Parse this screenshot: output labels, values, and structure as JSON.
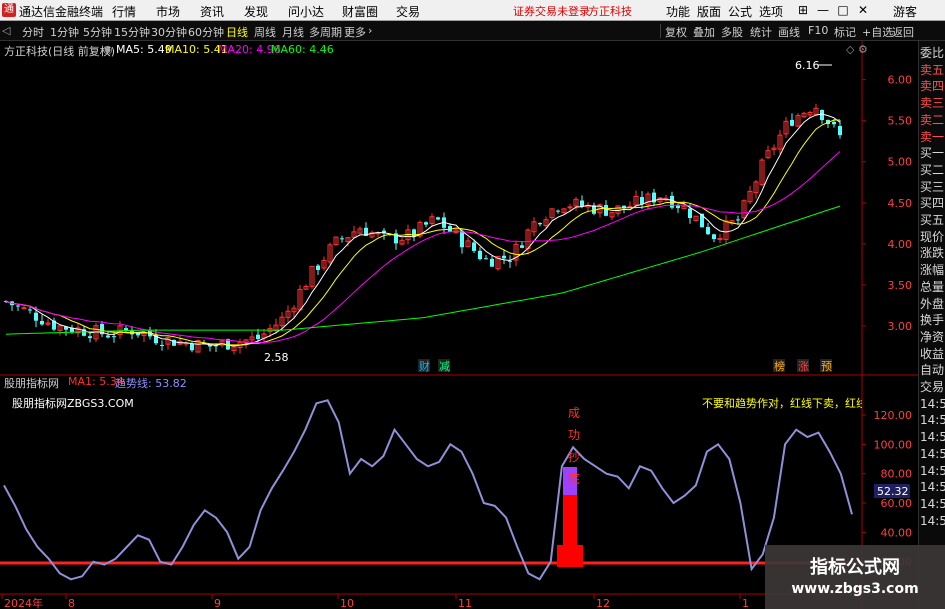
{
  "app": {
    "logo": "通",
    "title": "通达信金融终端",
    "menus": [
      "行情",
      "市场",
      "资讯",
      "发现",
      "问小达",
      "财富圈",
      "交易"
    ],
    "status": [
      "证券交易未登录",
      "方正科技"
    ],
    "right_menus": [
      "功能",
      "版面",
      "公式",
      "选项"
    ],
    "user": "游客"
  },
  "toolbar": {
    "periods": [
      "分时",
      "1分钟",
      "5分钟",
      "15分钟",
      "30分钟",
      "60分钟",
      "日线",
      "周线",
      "月线",
      "多周期",
      "更多"
    ],
    "active": "日线",
    "right_tools": [
      "复权",
      "叠加",
      "多股",
      "统计",
      "画线",
      "F10",
      "标记",
      "+自选",
      "返回"
    ]
  },
  "right_tabs": [
    "委比",
    "卖五",
    "卖四",
    "卖三",
    "卖二",
    "卖一",
    "买一",
    "买二",
    "买三",
    "买四",
    "买五",
    "现价",
    "涨跌",
    "涨幅",
    "总量",
    "外盘",
    "换手",
    "净资",
    "收益",
    "自动",
    "交易",
    "14:56",
    "14:56",
    "14:56",
    "14:56",
    "14:56",
    "14:56",
    "14:56",
    "14:56"
  ],
  "main_chart": {
    "stock_label": "方正科技(日线 前复权)",
    "ma": [
      {
        "label": "MA5: 5.49",
        "color": "#ffffff"
      },
      {
        "label": "MA10: 5.41",
        "color": "#ffff00"
      },
      {
        "label": "MA20: 4.96",
        "color": "#ff00ff"
      },
      {
        "label": "MA60: 4.46",
        "color": "#00ff00"
      }
    ],
    "y_ticks": [
      "6.00",
      "5.50",
      "5.00",
      "4.50",
      "4.00",
      "3.50",
      "3.00"
    ],
    "high_label": "6.16",
    "low_label": "2.58",
    "markers": [
      "财",
      "减",
      "榜",
      "涨",
      "预"
    ]
  },
  "indicator": {
    "title": "股朋指标网",
    "ma1": "MA1: 5.34",
    "trend": "趋势线: 53.82",
    "site": "股朋指标网ZBGS3.COM",
    "note": "不要和趋势作对，红线下卖，红线上买反",
    "signal_chars": [
      "成",
      "功",
      "抄",
      "底"
    ],
    "y_ticks": [
      "120.00",
      "100.00",
      "80.00",
      "60.00",
      "40.00",
      "20.00"
    ],
    "current_value": "52.32"
  },
  "x_axis": [
    "2024年",
    "8",
    "9",
    "10",
    "11",
    "12",
    "1"
  ],
  "watermark": {
    "line1": "指标公式网",
    "line2": "www.zbgs3.com"
  },
  "chart_data": [
    {
      "type": "line",
      "title": "方正科技(日线 前复权)",
      "x": [
        "2024-07",
        "2024-08",
        "2024-09",
        "2024-10",
        "2024-11",
        "2024-12",
        "2025-01"
      ],
      "series": [
        {
          "name": "MA5",
          "values": [
            3.1,
            2.9,
            2.8,
            4.0,
            4.3,
            4.4,
            5.49
          ]
        },
        {
          "name": "MA10",
          "values": [
            3.1,
            2.95,
            2.8,
            3.8,
            4.2,
            4.4,
            5.41
          ]
        },
        {
          "name": "MA20",
          "values": [
            3.05,
            3.0,
            2.85,
            3.6,
            4.0,
            4.2,
            4.96
          ]
        },
        {
          "name": "MA60",
          "values": [
            2.9,
            2.95,
            2.95,
            3.1,
            3.4,
            3.9,
            4.46
          ]
        }
      ],
      "ylim": [
        2.5,
        6.3
      ]
    },
    {
      "type": "line",
      "title": "股朋指标网",
      "x": [
        "2024-07",
        "2024-08",
        "2024-09",
        "2024-10",
        "2024-11",
        "2024-12",
        "2025-01"
      ],
      "series": [
        {
          "name": "趋势线",
          "values": [
            60,
            12,
            45,
            130,
            80,
            15,
            52.32
          ]
        }
      ],
      "ylim": [
        0,
        135
      ]
    }
  ]
}
